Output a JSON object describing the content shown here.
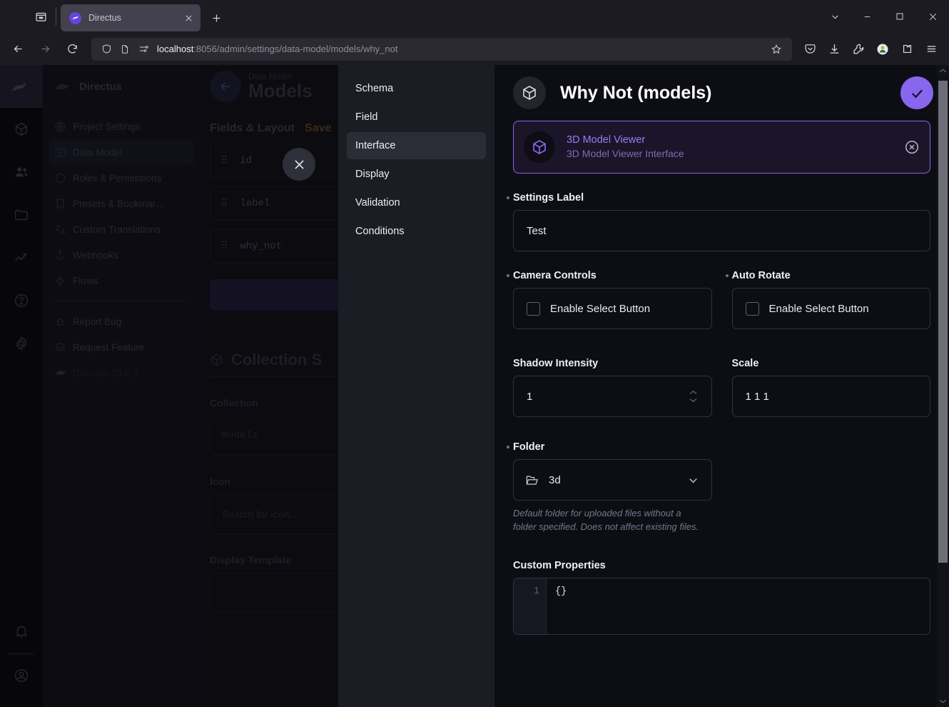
{
  "browser": {
    "list_tabs_icon": "list-tabs-icon",
    "tab": {
      "title": "Directus",
      "favicon": "directus-favicon",
      "close_icon": "close-icon"
    },
    "new_tab_icon": "plus-icon",
    "window_controls": {
      "chevron": "chevron-down-icon",
      "minimize": "minimize-icon",
      "maximize": "maximize-icon",
      "close": "close-icon"
    },
    "nav": {
      "back_icon": "arrow-left-icon",
      "forward_icon": "arrow-right-icon",
      "reload_icon": "reload-icon"
    },
    "url": {
      "host": "localhost",
      "path": ":8056/admin/settings/data-model/models/why_not",
      "full": "localhost:8056/admin/settings/data-model/models/why_not",
      "shield_icon": "shield-icon",
      "page-icon": "page-icon",
      "permissions_icon": "permissions-icon",
      "bookmark_icon": "star-icon"
    },
    "toolbar": [
      {
        "name": "pocket-icon"
      },
      {
        "name": "downloads-icon"
      },
      {
        "name": "wrench-icon"
      },
      {
        "name": "extension-avatar-icon"
      },
      {
        "name": "extensions-icon"
      },
      {
        "name": "app-menu-icon"
      }
    ]
  },
  "app": {
    "rail": [
      {
        "name": "logo",
        "icon": "directus-rabbit-logo"
      },
      {
        "name": "content",
        "icon": "box-icon"
      },
      {
        "name": "users",
        "icon": "users-icon"
      },
      {
        "name": "files",
        "icon": "folder-icon"
      },
      {
        "name": "insights",
        "icon": "insights-icon"
      },
      {
        "name": "docs",
        "icon": "help-icon"
      },
      {
        "name": "settings",
        "icon": "gear-icon"
      },
      {
        "name": "notifications",
        "icon": "bell-icon"
      },
      {
        "name": "account",
        "icon": "account-icon"
      }
    ],
    "module_title": "Directus",
    "module_nav": [
      {
        "label": "Project Settings",
        "icon": "globe-icon",
        "active": false
      },
      {
        "label": "Data Model",
        "icon": "list-icon",
        "active": true
      },
      {
        "label": "Roles & Permissions",
        "icon": "shield-icon",
        "active": false
      },
      {
        "label": "Presets & Bookmar…",
        "icon": "bookmark-icon",
        "active": false
      },
      {
        "label": "Custom Translations",
        "icon": "translate-icon",
        "active": false
      },
      {
        "label": "Webhooks",
        "icon": "anchor-icon",
        "active": false
      },
      {
        "label": "Flows",
        "icon": "bolt-icon",
        "active": false
      }
    ],
    "module_nav_footer": [
      {
        "label": "Report Bug",
        "icon": "bug-icon"
      },
      {
        "label": "Request Feature",
        "icon": "badge-check-icon"
      },
      {
        "label": "Directus 10.6.3",
        "icon": "directus-rabbit-logo"
      }
    ],
    "main": {
      "breadcrumb": "Data Model",
      "title": "Models",
      "back_icon": "arrow-left-icon",
      "fields_heading": "Fields & Layout",
      "save_link": "Save",
      "fields": [
        {
          "name": "id"
        },
        {
          "name": "label"
        },
        {
          "name": "why_not"
        }
      ],
      "collection_setup_heading": "Collection S",
      "collection_label": "Collection",
      "collection_value": "models",
      "icon_label": "Icon",
      "icon_placeholder": "Search for icon...",
      "display_template_label": "Display Template",
      "display_template_value": ""
    },
    "modal_close_icon": "close-icon"
  },
  "drawer": {
    "nav": [
      {
        "label": "Schema",
        "active": false
      },
      {
        "label": "Field",
        "active": false
      },
      {
        "label": "Interface",
        "active": true
      },
      {
        "label": "Display",
        "active": false
      },
      {
        "label": "Validation",
        "active": false
      },
      {
        "label": "Conditions",
        "active": false
      }
    ],
    "header": {
      "icon": "box-icon",
      "title": "Why Not (models)",
      "save_icon": "check-icon",
      "save_color": "#8866ee"
    },
    "interface_card": {
      "icon": "box-icon",
      "name": "3D Model Viewer",
      "description": "3D Model Viewer Interface",
      "deselect_icon": "circle-x-icon",
      "border_color": "#8866ee"
    },
    "fields": {
      "settings_label": {
        "label": "Settings Label",
        "required": true,
        "value": "Test"
      },
      "camera_controls": {
        "label": "Camera Controls",
        "required": true,
        "checkbox_label": "Enable Select Button",
        "checked": false
      },
      "auto_rotate": {
        "label": "Auto Rotate",
        "required": true,
        "checkbox_label": "Enable Select Button",
        "checked": false
      },
      "shadow_intensity": {
        "label": "Shadow Intensity",
        "required": false,
        "value": "1",
        "stepper_up_icon": "chevron-up-icon",
        "stepper_down_icon": "chevron-down-icon"
      },
      "scale": {
        "label": "Scale",
        "required": false,
        "value": "1 1 1"
      },
      "folder": {
        "label": "Folder",
        "required": true,
        "value": "3d",
        "folder_icon": "folder-open-icon",
        "chevron_icon": "chevron-down-icon",
        "help": "Default folder for uploaded files without a folder specified. Does not affect existing files."
      },
      "custom_properties": {
        "label": "Custom Properties",
        "line_number": "1",
        "value": "{}"
      }
    }
  },
  "scrollbar": {
    "up_icon": "chevron-up-icon",
    "down_icon": "chevron-down-icon"
  }
}
